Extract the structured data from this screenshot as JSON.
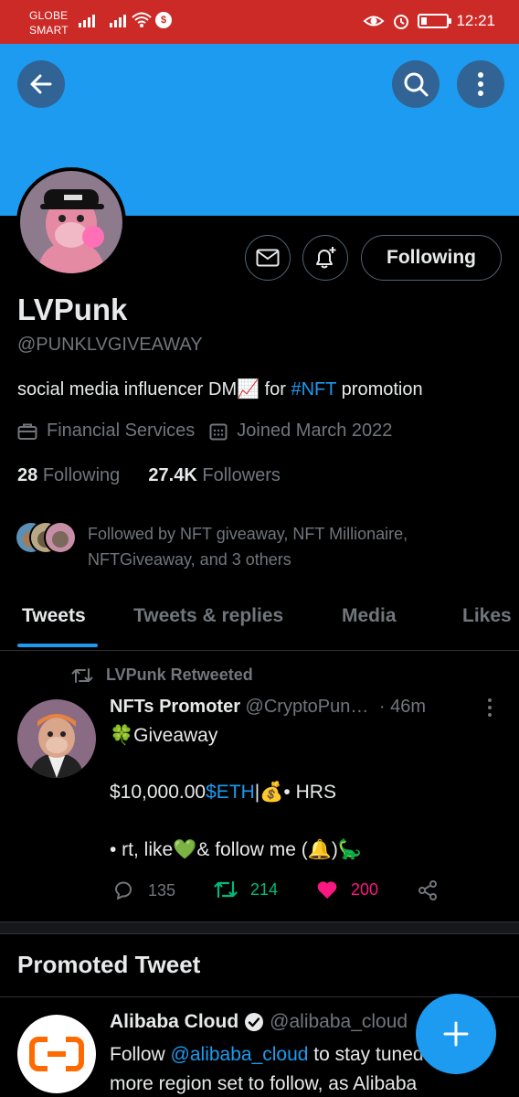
{
  "status_bar": {
    "carrier_line1": "GLOBE",
    "carrier_line2": "SMART",
    "time": "12:21",
    "icons": [
      "signal-icon",
      "wifi-icon",
      "s-app-icon",
      "eye-icon",
      "alarm-icon",
      "battery-icon"
    ],
    "color": "#cc2a27"
  },
  "banner": {
    "color": "#1d9bf0"
  },
  "profile": {
    "name": "LVPunk",
    "handle": "@PUNKLVGIVEAWAY",
    "bio_prefix": "social media influencer DM",
    "bio_emoji": "📈",
    "bio_mid": " for ",
    "bio_hashtag": "#NFT",
    "bio_suffix": " promotion",
    "category": "Financial Services",
    "joined": "Joined March 2022",
    "following_count": "28",
    "following_label": "Following",
    "followers_count": "27.4K",
    "followers_label": "Followers",
    "followed_by": "Followed by NFT giveaway, NFT Millionaire, NFTGiveaway, and 3 others",
    "follow_button": "Following"
  },
  "tabs": [
    {
      "label": "Tweets",
      "active": true
    },
    {
      "label": "Tweets & replies",
      "active": false
    },
    {
      "label": "Media",
      "active": false
    },
    {
      "label": "Likes",
      "active": false
    }
  ],
  "tweet": {
    "retweeted_by": "LVPunk Retweeted",
    "author_name": "NFTs Promoter",
    "author_handle": "@CryptoPun…",
    "time": "· 46m",
    "line1_emoji": "🍀",
    "line1_text": " Giveaway",
    "line2_prefix": "$10,000.00 ",
    "line2_cashtag": "$ETH",
    "line2_mid": " | ",
    "line2_emoji": "💰",
    "line2_suffix": "•  HRS",
    "line3_prefix": "• rt, like ",
    "line3_heart": "💚",
    "line3_mid": " & follow me (",
    "line3_bell": "🔔",
    "line3_close": ") ",
    "line3_dino": "🦕",
    "replies": "135",
    "retweets": "214",
    "likes": "200",
    "retweet_color": "#00ba7c",
    "like_color": "#f91880"
  },
  "promoted": {
    "header": "Promoted Tweet",
    "author_name": "Alibaba Cloud",
    "author_handle": "@alibaba_cloud",
    "text_prefix": "Follow ",
    "text_mention": "@alibaba_cloud",
    "text_suffix": " to stay tuned for more region set to follow, as Alibaba"
  }
}
